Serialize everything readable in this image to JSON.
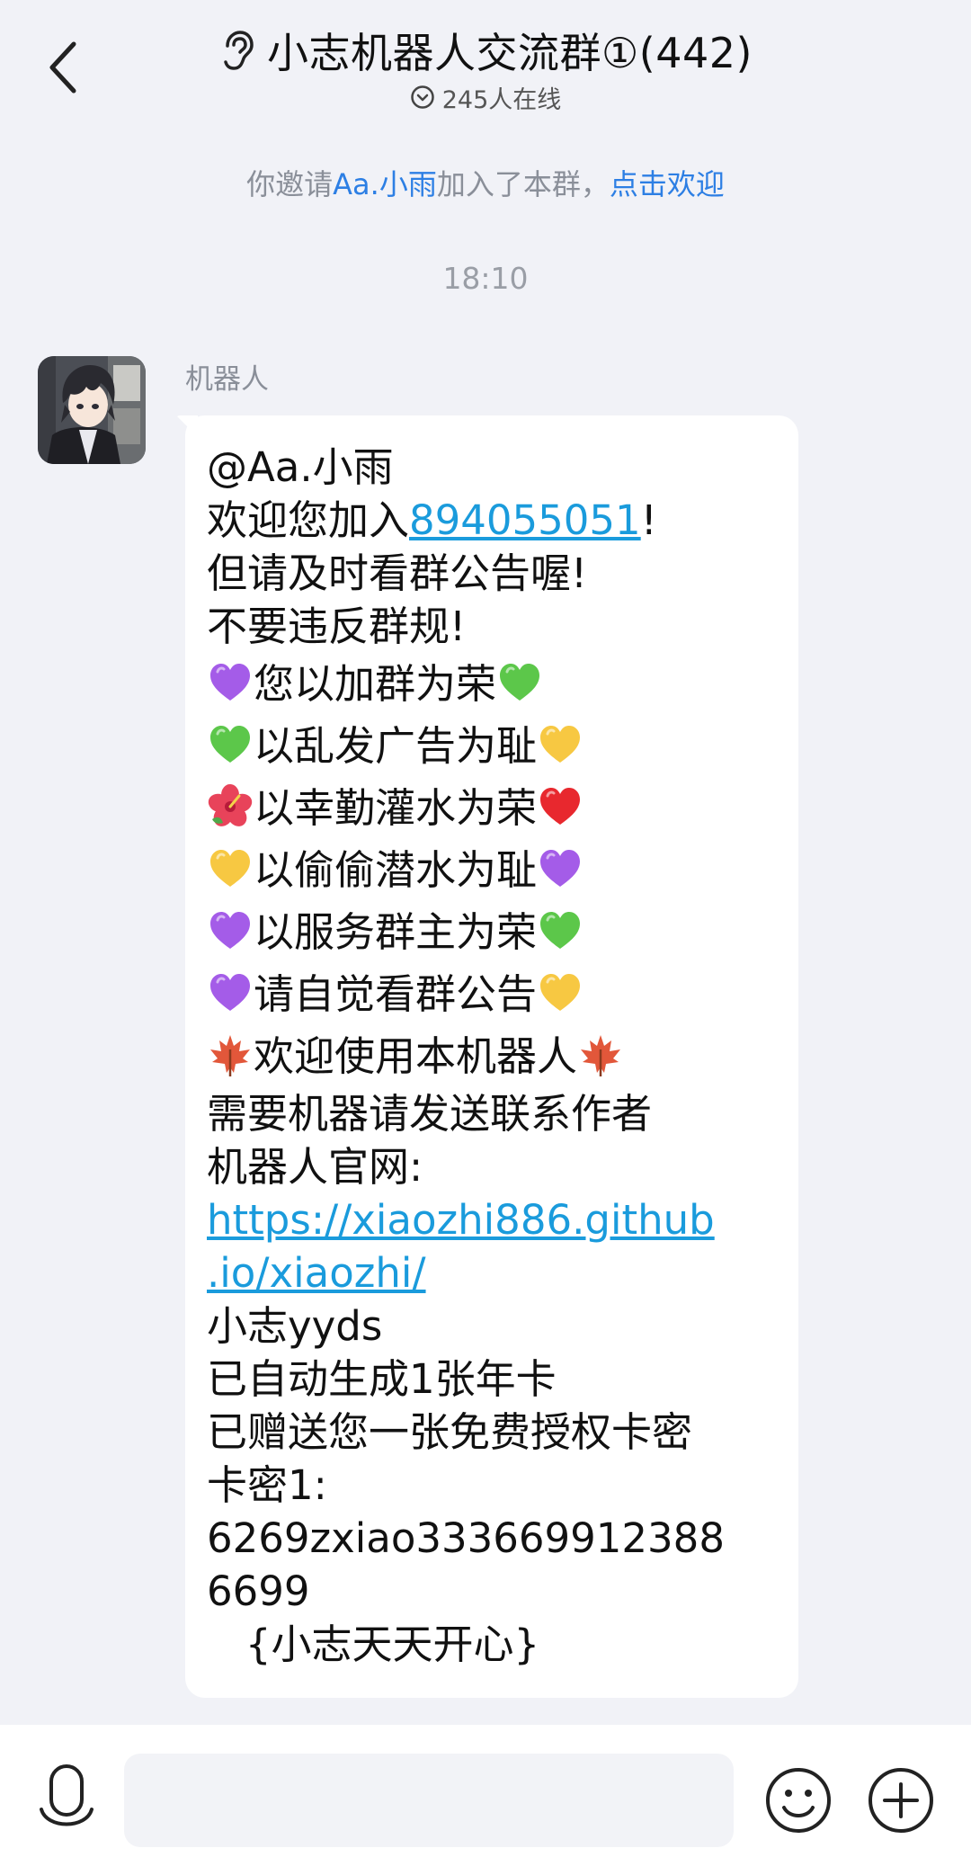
{
  "header": {
    "title": "小志机器人交流群①(442)",
    "online_text": "245人在线"
  },
  "system_message": {
    "prefix": "你邀请",
    "user": "Aa.小雨",
    "middle": "加入了本群，",
    "action": "点击欢迎"
  },
  "timestamp": "18:10",
  "message": {
    "sender": "机器人",
    "mention": "@Aa.小雨",
    "line_welcome_prefix": "欢迎您加入",
    "group_number": "894055051",
    "line_welcome_suffix": "!",
    "line_notice": "但请及时看群公告喔!",
    "line_rules": "不要违反群规!",
    "rules": [
      {
        "left_emoji": "purple-heart",
        "text": "您以加群为荣",
        "right_emoji": "green-heart"
      },
      {
        "left_emoji": "green-heart",
        "text": "以乱发广告为耻",
        "right_emoji": "yellow-heart"
      },
      {
        "left_emoji": "hibiscus",
        "text": "以幸勤灌水为荣",
        "right_emoji": "red-heart"
      },
      {
        "left_emoji": "yellow-heart",
        "text": "以偷偷潜水为耻",
        "right_emoji": "purple-heart"
      },
      {
        "left_emoji": "purple-heart",
        "text": "以服务群主为荣",
        "right_emoji": "green-heart"
      },
      {
        "left_emoji": "purple-heart",
        "text": "请自觉看群公告",
        "right_emoji": "yellow-heart"
      },
      {
        "left_emoji": "maple-leaf",
        "text": "欢迎使用本机器人",
        "right_emoji": "maple-leaf"
      }
    ],
    "line_contact": "需要机器请发送联系作者",
    "line_site_label": "机器人官网:",
    "site_url_line1": "https://xiaozhi886.github",
    "site_url_line2": ".io/xiaozhi/",
    "line_yyds": "小志yyds",
    "line_generated": "已自动生成1张年卡",
    "line_gift": "已赠送您一张免费授权卡密",
    "line_card_label": "卡密1:",
    "card_code_line1": "6269zxiao333669912388",
    "card_code_line2": "6699",
    "line_closing": "   {小志天天开心}"
  },
  "input": {
    "placeholder": ""
  },
  "colors": {
    "link": "#1a9bdc",
    "system_link": "#2d7fe4",
    "purple-heart": "#a45ce8",
    "green-heart": "#5cc74a",
    "yellow-heart": "#f7c842",
    "red-heart": "#e8282e",
    "hibiscus": "#e8435a",
    "maple-leaf": "#e2573a"
  }
}
